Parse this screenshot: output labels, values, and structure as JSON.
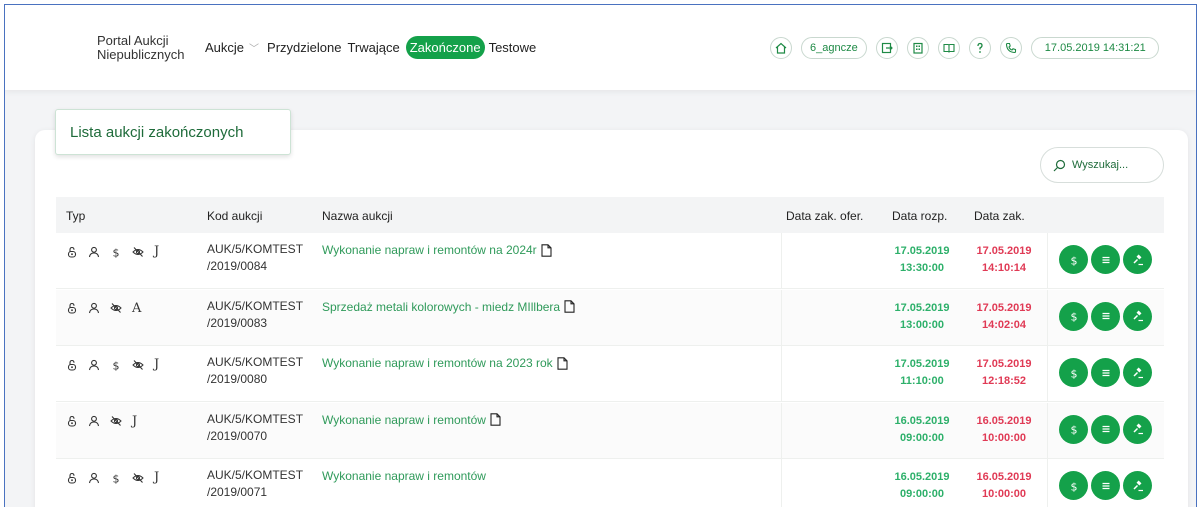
{
  "header": {
    "brand_line1": "Portal Aukcji",
    "brand_line2": "Niepublicznych",
    "nav": [
      {
        "label": "Aukcje",
        "dropdown": true
      },
      {
        "label": "Przydzielone"
      },
      {
        "label": "Trwające"
      },
      {
        "label": "Zakończone",
        "active": true
      },
      {
        "label": "Testowe"
      }
    ],
    "user": "6_agncze",
    "datetime": "17.05.2019 14:31:21",
    "icons": [
      "home-icon",
      "logout-icon",
      "building-icon",
      "book-icon",
      "help-icon",
      "phone-icon"
    ]
  },
  "page": {
    "title": "Lista aukcji zakończonych",
    "search_placeholder": "Wyszukaj..."
  },
  "table": {
    "columns": [
      "Typ",
      "Kod aukcji",
      "Nazwa aukcji",
      "Data zak. ofer.",
      "Data rozp.",
      "Data zak."
    ],
    "rows": [
      {
        "icons": [
          "lock",
          "user",
          "dollar",
          "eye-off"
        ],
        "letter": "J",
        "code_1": "AUK/5/KOMTEST",
        "code_2": "/2019/0084",
        "name": "Wykonanie napraw i remontów na 2024r",
        "doc": true,
        "offer_date": "",
        "start_date": "17.05.2019",
        "start_time": "13:30:00",
        "end_date": "17.05.2019",
        "end_time": "14:10:14"
      },
      {
        "icons": [
          "lock",
          "user",
          "eye-off"
        ],
        "letter": "A",
        "code_1": "AUK/5/KOMTEST",
        "code_2": "/2019/0083",
        "name": "Sprzedaż metali kolorowych - miedz MIllbera",
        "doc": true,
        "offer_date": "",
        "start_date": "17.05.2019",
        "start_time": "13:00:00",
        "end_date": "17.05.2019",
        "end_time": "14:02:04"
      },
      {
        "icons": [
          "lock",
          "user",
          "dollar",
          "eye-off"
        ],
        "letter": "J",
        "code_1": "AUK/5/KOMTEST",
        "code_2": "/2019/0080",
        "name": "Wykonanie napraw i remontów na 2023 rok",
        "doc": true,
        "offer_date": "",
        "start_date": "17.05.2019",
        "start_time": "11:10:00",
        "end_date": "17.05.2019",
        "end_time": "12:18:52"
      },
      {
        "icons": [
          "lock",
          "user",
          "eye-off"
        ],
        "letter": "J",
        "code_1": "AUK/5/KOMTEST",
        "code_2": "/2019/0070",
        "name": "Wykonanie napraw i remontów",
        "doc": true,
        "offer_date": "",
        "start_date": "16.05.2019",
        "start_time": "09:00:00",
        "end_date": "16.05.2019",
        "end_time": "10:00:00"
      },
      {
        "icons": [
          "lock",
          "user",
          "dollar",
          "eye-off"
        ],
        "letter": "J",
        "code_1": "AUK/5/KOMTEST",
        "code_2": "/2019/0071",
        "name": "Wykonanie napraw i remontów",
        "doc": false,
        "offer_date": "",
        "start_date": "16.05.2019",
        "start_time": "09:00:00",
        "end_date": "16.05.2019",
        "end_time": "10:00:00"
      }
    ],
    "row_actions": [
      "dollar-icon",
      "menu-icon",
      "gavel-icon"
    ]
  },
  "colors": {
    "accent": "#14a14a",
    "start": "#2db06a",
    "end": "#e03a55"
  }
}
